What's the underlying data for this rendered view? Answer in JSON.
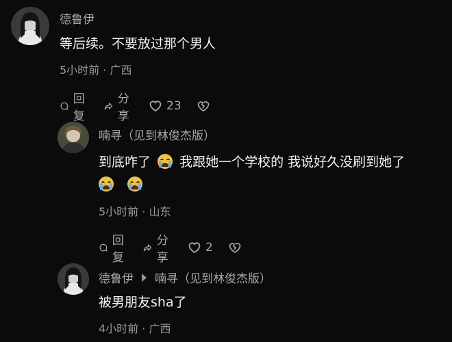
{
  "comments": [
    {
      "username": "德鲁伊",
      "text": "等后续。不要放过那个男人",
      "meta": "5小时前 · 广西",
      "actions": {
        "reply": "回复",
        "share": "分享",
        "likes": "23"
      }
    },
    {
      "username": "喃寻（见到林俊杰版）",
      "text_a": "到底咋了",
      "text_b": "我跟她一个学校的 我说好久没刷到她了",
      "meta": "5小时前 · 山东",
      "actions": {
        "reply": "回复",
        "share": "分享",
        "likes": "2"
      }
    },
    {
      "username": "德鲁伊",
      "reply_to": "喃寻（见到林俊杰版）",
      "text": "被男朋友sha了",
      "meta": "4小时前 · 广西"
    }
  ],
  "icons": {
    "crying": "loudly-crying-face-emoji",
    "comment": "comment-bubble-icon",
    "share": "share-arrow-icon",
    "like": "heart-icon",
    "dislike": "broken-heart-icon",
    "reply_arrow": "reply-arrow-icon"
  }
}
